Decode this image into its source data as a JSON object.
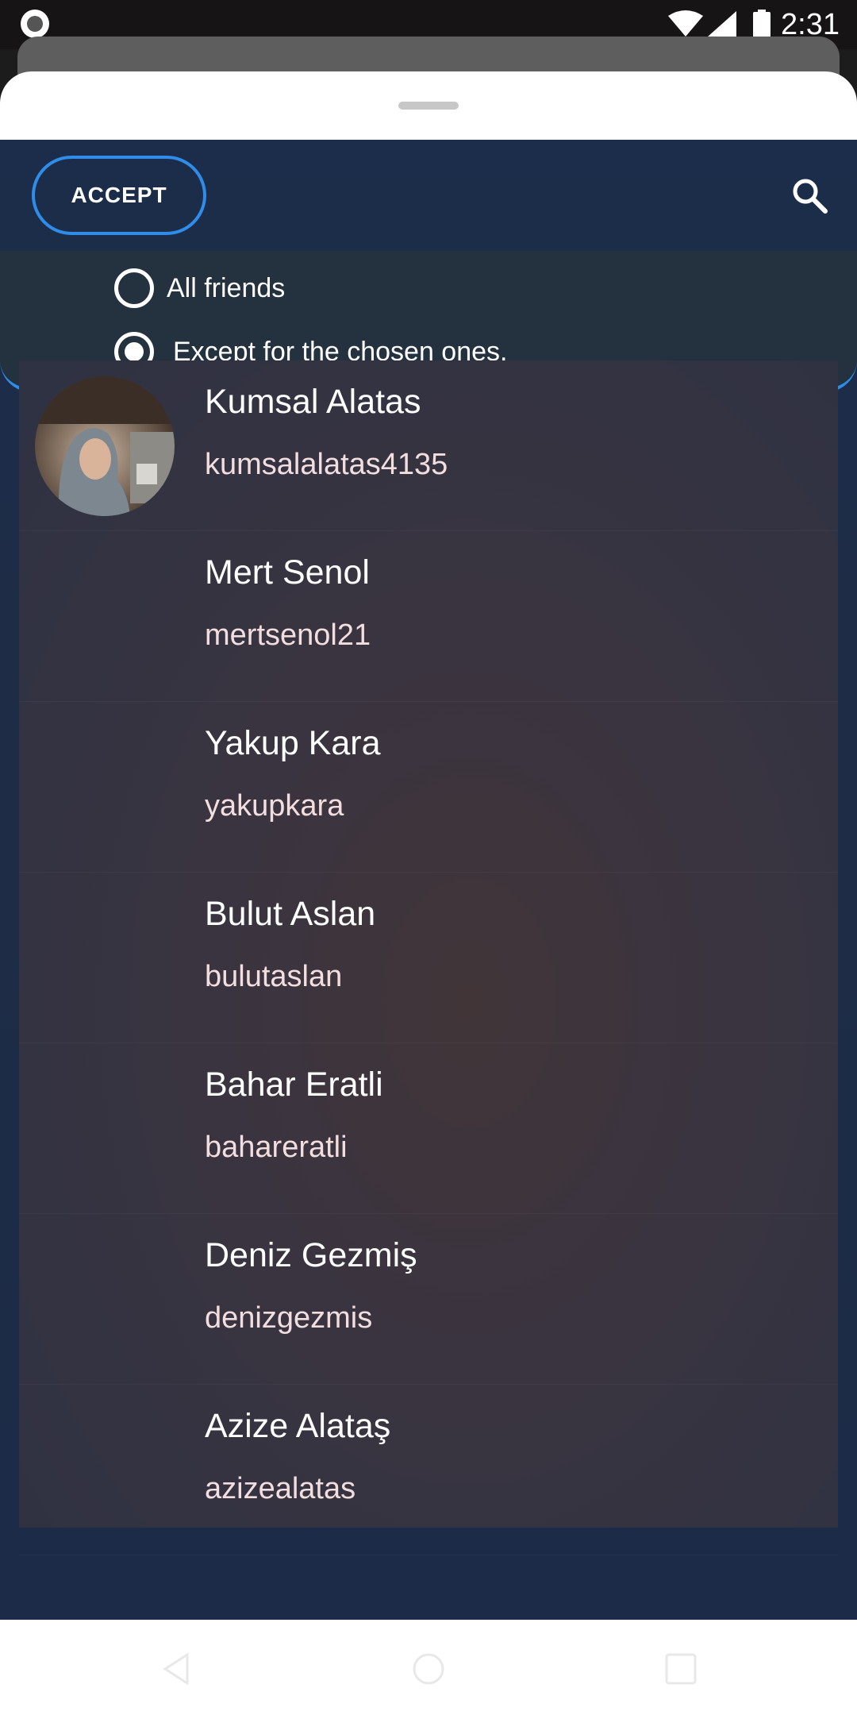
{
  "status_bar": {
    "time": "2:31",
    "icons": [
      "screen-record-icon",
      "wifi-icon",
      "cell-signal-icon",
      "battery-icon"
    ]
  },
  "toolbar": {
    "accept_label": "ACCEPT",
    "search_icon": "search-icon"
  },
  "visibility_options": [
    {
      "label": "All friends",
      "selected": false
    },
    {
      "label": "Except for the chosen ones.",
      "selected": true
    }
  ],
  "friends": [
    {
      "name": "Kumsal Alatas",
      "username": "kumsalalatas4135",
      "has_avatar": true
    },
    {
      "name": "Mert Senol",
      "username": "mertsenol21",
      "has_avatar": false
    },
    {
      "name": "Yakup Kara",
      "username": "yakupkara",
      "has_avatar": false
    },
    {
      "name": "Bulut Aslan",
      "username": "bulutaslan",
      "has_avatar": false
    },
    {
      "name": "Bahar Eratli",
      "username": "bahareratli",
      "has_avatar": false
    },
    {
      "name": "Deniz Gezmiş",
      "username": "denizgezmis",
      "has_avatar": false
    },
    {
      "name": "Azize Alataş",
      "username": "azizealatas",
      "has_avatar": false
    }
  ],
  "colors": {
    "accent": "#2f8ce8",
    "panel_background": "#1c2d4b",
    "options_background": "#24313f",
    "username_text": "#f2dede"
  },
  "nav_bar": {
    "icons": [
      "back-icon",
      "home-icon",
      "recents-icon"
    ]
  }
}
